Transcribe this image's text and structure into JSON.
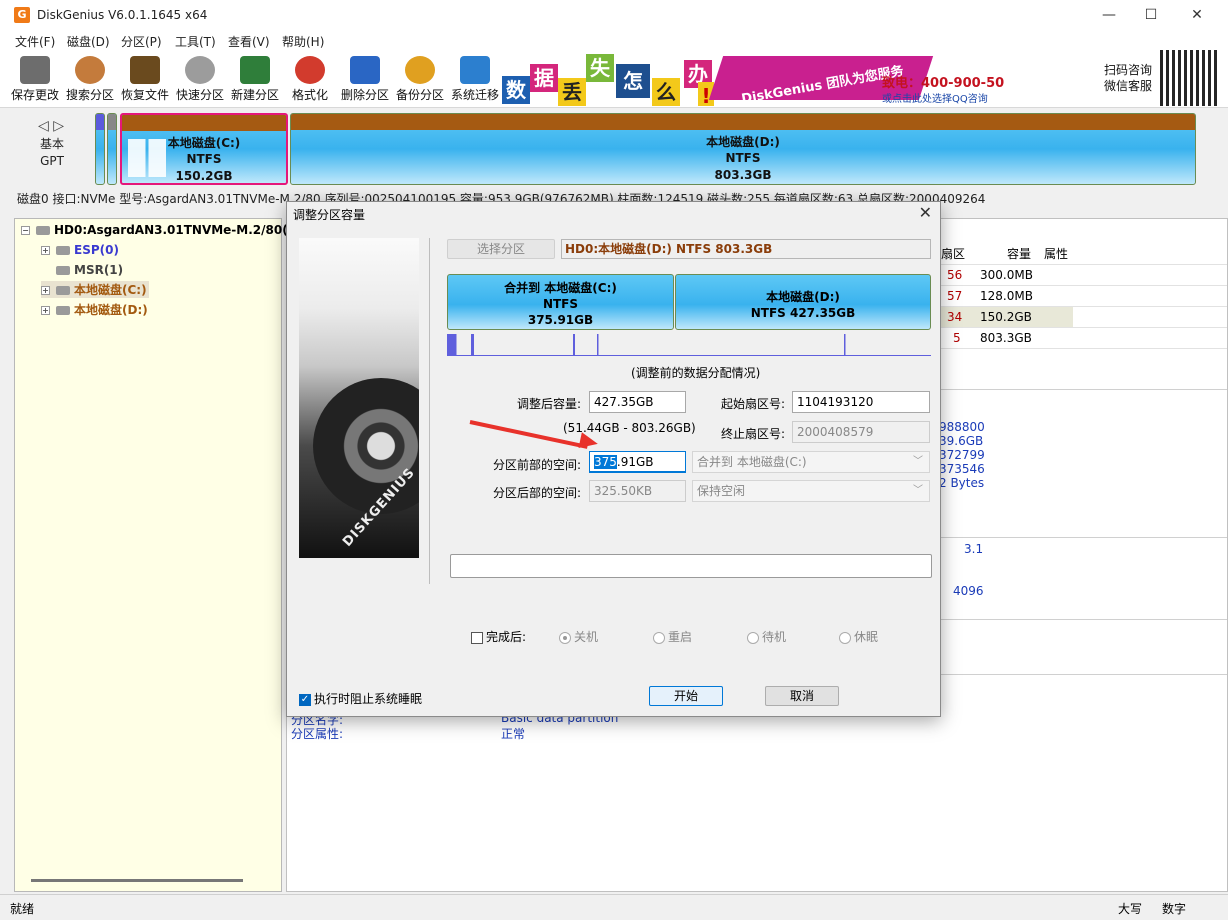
{
  "window": {
    "title": "DiskGenius V6.0.1.1645 x64"
  },
  "menu": [
    "文件(F)",
    "磁盘(D)",
    "分区(P)",
    "工具(T)",
    "查看(V)",
    "帮助(H)"
  ],
  "toolbar": {
    "items": [
      {
        "label": "保存更改",
        "icon": "save-icon",
        "color": "#6d6d6d"
      },
      {
        "label": "搜索分区",
        "icon": "magnifier-icon",
        "color": "#c47b3c"
      },
      {
        "label": "恢复文件",
        "icon": "recover-icon",
        "color": "#6a4a1e"
      },
      {
        "label": "快速分区",
        "icon": "disk-icon",
        "color": "#9c9c9c"
      },
      {
        "label": "新建分区",
        "icon": "layers-icon",
        "color": "#2f7e3a"
      },
      {
        "label": "格式化",
        "icon": "lifebuoy-icon",
        "color": "#d23b2d"
      },
      {
        "label": "删除分区",
        "icon": "trash-icon",
        "color": "#2a66c4"
      },
      {
        "label": "备份分区",
        "icon": "pie-icon",
        "color": "#e0a020"
      },
      {
        "label": "系统迁移",
        "icon": "migrate-icon",
        "color": "#2c7fcf"
      }
    ]
  },
  "banner": {
    "chars": [
      "数",
      "据",
      "丢",
      "失",
      "怎",
      "么",
      "办",
      "!"
    ],
    "slogan": "DiskGenius 团队为您服务",
    "phone": "致电：400-900-5080",
    "qq": "或点击此处选择QQ咨询"
  },
  "qr_text": [
    "扫码咨询",
    "微信客服"
  ],
  "diskmap": {
    "nav_label": [
      "基本",
      "GPT"
    ],
    "partitions": [
      {
        "name": "本地磁盘(C:)",
        "fs": "NTFS",
        "size": "150.2GB"
      },
      {
        "name": "本地磁盘(D:)",
        "fs": "NTFS",
        "size": "803.3GB"
      }
    ]
  },
  "disk_info": "磁盘0 接口:NVMe  型号:AsgardAN3.01TNVMe-M.2/80  序列号:002504100195  容量:953.9GB(976762MB)  柱面数:124519  磁头数:255  每道扇区数:63  总扇区数:2000409264",
  "tree": {
    "root": "HD0:AsgardAN3.01TNVMe-M.2/80(95",
    "items": [
      "ESP(0)",
      "MSR(1)",
      "本地磁盘(C:)",
      "本地磁盘(D:)"
    ]
  },
  "grid": {
    "headers": [
      "扇区",
      "容量",
      "属性"
    ],
    "rows": [
      {
        "sector": "56",
        "size": "300.0MB"
      },
      {
        "sector": "57",
        "size": "128.0MB"
      },
      {
        "sector": "34",
        "size": "150.2GB"
      },
      {
        "sector": "5",
        "size": "803.3GB"
      }
    ]
  },
  "details": {
    "values": [
      "988800",
      "39.6GB",
      "372799",
      "373546",
      "2 Bytes"
    ],
    "v31": "3.1",
    "v4096": "4096",
    "labels": [
      "分区名字:",
      "分区属性:"
    ],
    "label_values": [
      "Basic data partition",
      "正常"
    ]
  },
  "status": {
    "left": "就绪",
    "caps": "大写",
    "num": "数字"
  },
  "dialog": {
    "title": "调整分区容量",
    "select_button": "选择分区",
    "selected_partition": "HD0:本地磁盘(D:) NTFS 803.3GB",
    "bar_left": [
      "合并到 本地磁盘(C:)",
      "NTFS",
      "375.91GB"
    ],
    "bar_right": [
      "本地磁盘(D:)",
      "NTFS 427.35GB"
    ],
    "bar_left_fraction": 0.468,
    "graph_caption": "(调整前的数据分配情况)",
    "size_label": "调整后容量:",
    "size_value": "427.35GB",
    "range_hint": "(51.44GB - 803.26GB)",
    "start_sector_label": "起始扇区号:",
    "start_sector_value": "1104193120",
    "end_sector_label": "终止扇区号:",
    "end_sector_value": "2000408579",
    "before_label": "分区前部的空间:",
    "before_value_selected": "375",
    "before_value_rest": ".91GB",
    "before_combo": "合并到 本地磁盘(C:)",
    "after_label": "分区后部的空间:",
    "after_value": "325.50KB",
    "after_combo": "保持空闲",
    "finish_label": "完成后:",
    "finish_options": [
      "关机",
      "重启",
      "待机",
      "休眠"
    ],
    "prevent_sleep": "执行时阻止系统睡眠",
    "start_button": "开始",
    "cancel_button": "取消",
    "brand": "DISKGENIUS"
  }
}
